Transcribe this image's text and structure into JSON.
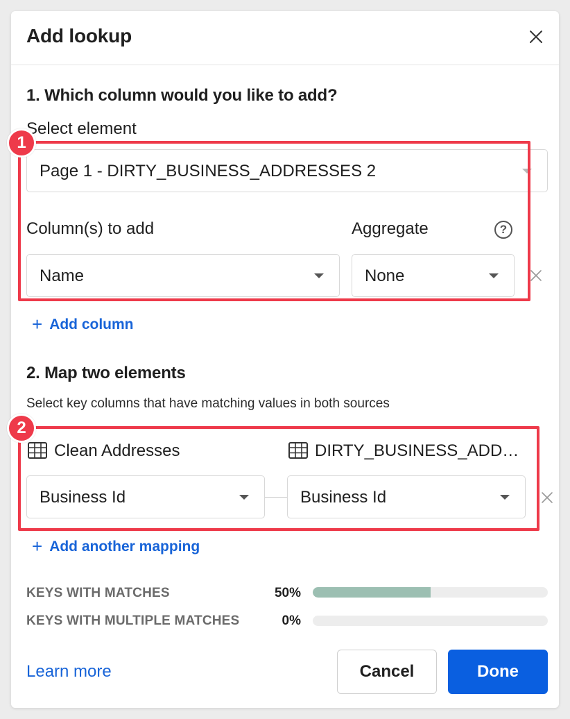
{
  "dialog": {
    "title": "Add lookup",
    "close_icon": "close-icon"
  },
  "section1": {
    "heading": "1. Which column would you like to add?",
    "select_element_label": "Select element",
    "select_element_value": "Page 1 - DIRTY_BUSINESS_ADDRESSES 2",
    "columns_label": "Column(s) to add",
    "aggregate_label": "Aggregate",
    "help_glyph": "?",
    "column_value": "Name",
    "aggregate_value": "None",
    "add_column_label": "Add column"
  },
  "section2": {
    "heading": "2. Map two elements",
    "subtext": "Select key columns that have matching values in both sources",
    "left_source": "Clean Addresses",
    "right_source": "DIRTY_BUSINESS_ADD…",
    "left_key": "Business Id",
    "right_key": "Business Id",
    "add_mapping_label": "Add another mapping"
  },
  "stats": [
    {
      "label": "KEYS WITH MATCHES",
      "percent_text": "50%",
      "fraction": 0.5
    },
    {
      "label": "KEYS WITH MULTIPLE MATCHES",
      "percent_text": "0%",
      "fraction": 0.0
    }
  ],
  "footer": {
    "learn_more": "Learn more",
    "cancel": "Cancel",
    "done": "Done"
  },
  "callouts": [
    "1",
    "2"
  ],
  "colors": {
    "accent": "#0a5fe0",
    "link": "#1864d8",
    "callout": "#ee3a4a",
    "bar_fill": "#9cbfb2"
  }
}
